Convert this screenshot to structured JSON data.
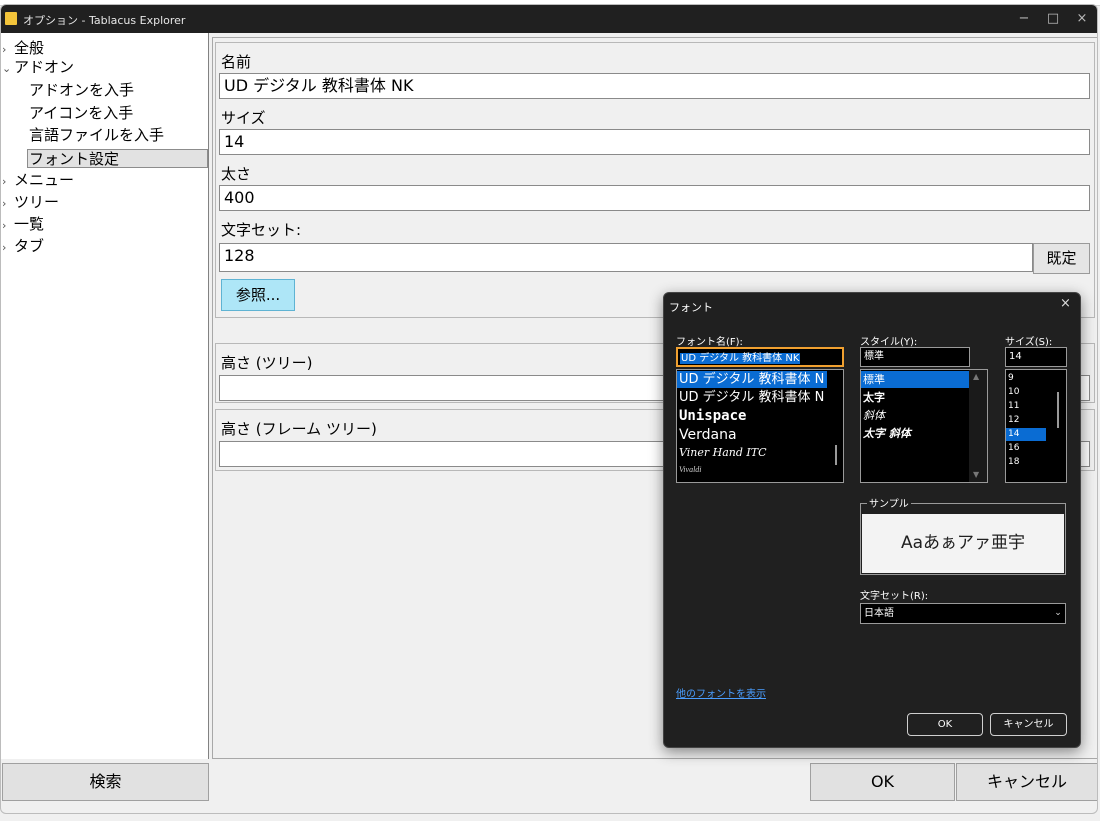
{
  "window": {
    "title": "オプション - Tablacus Explorer",
    "minimize": "−",
    "maximize": "□",
    "close": "×"
  },
  "sidebar": {
    "items": [
      {
        "label": "全般",
        "chevron": "›",
        "level": 0
      },
      {
        "label": "アドオン",
        "chevron": "⌄",
        "level": 0
      },
      {
        "label": "アドオンを入手",
        "level": 1
      },
      {
        "label": "アイコンを入手",
        "level": 1
      },
      {
        "label": "言語ファイルを入手",
        "level": 1
      },
      {
        "label": "フォント設定",
        "level": 1,
        "selected": true
      },
      {
        "label": "メニュー",
        "chevron": "›",
        "level": 0
      },
      {
        "label": "ツリー",
        "chevron": "›",
        "level": 0
      },
      {
        "label": "一覧",
        "chevron": "›",
        "level": 0
      },
      {
        "label": "タブ",
        "chevron": "›",
        "level": 0
      }
    ]
  },
  "form": {
    "name_label": "名前",
    "name_value": "UD デジタル 教科書体 NK",
    "size_label": "サイズ",
    "size_value": "14",
    "weight_label": "太さ",
    "weight_value": "400",
    "charset_label": "文字セット:",
    "charset_value": "128",
    "default_button": "既定",
    "browse_button": "参照...",
    "tree_height_label": "高さ (ツリー)",
    "frame_tree_height_label": "高さ (フレーム ツリー)"
  },
  "footer": {
    "search": "検索",
    "ok": "OK",
    "cancel": "キャンセル"
  },
  "font_dialog": {
    "title": "フォント",
    "close": "×",
    "font_name_label": "フォント名(F):",
    "font_name_value": "UD デジタル 教科書体 NK",
    "style_label": "スタイル(Y):",
    "style_value": "標準",
    "size_label": "サイズ(S):",
    "size_value": "14",
    "fonts": [
      "UD デジタル 教科書体 N",
      "UD デジタル 教科書体 N",
      "Unispace",
      "Verdana",
      "Viner Hand ITC",
      "Vivaldi"
    ],
    "styles": [
      "標準",
      "太字",
      "斜体",
      "太字 斜体"
    ],
    "sizes": [
      "9",
      "10",
      "11",
      "12",
      "14",
      "16",
      "18"
    ],
    "sample_label": "サンプル",
    "sample_text": "Aaあぁアァ亜宇",
    "charset_label": "文字セット(R):",
    "charset_value": "日本語",
    "more_fonts": "他のフォントを表示",
    "ok": "OK",
    "cancel": "キャンセル"
  },
  "colors": {
    "accent": "#0a6cd3",
    "highlight_border": "#f0a030",
    "browse_bg": "#aee6f7",
    "dialog_bg": "#202020"
  }
}
